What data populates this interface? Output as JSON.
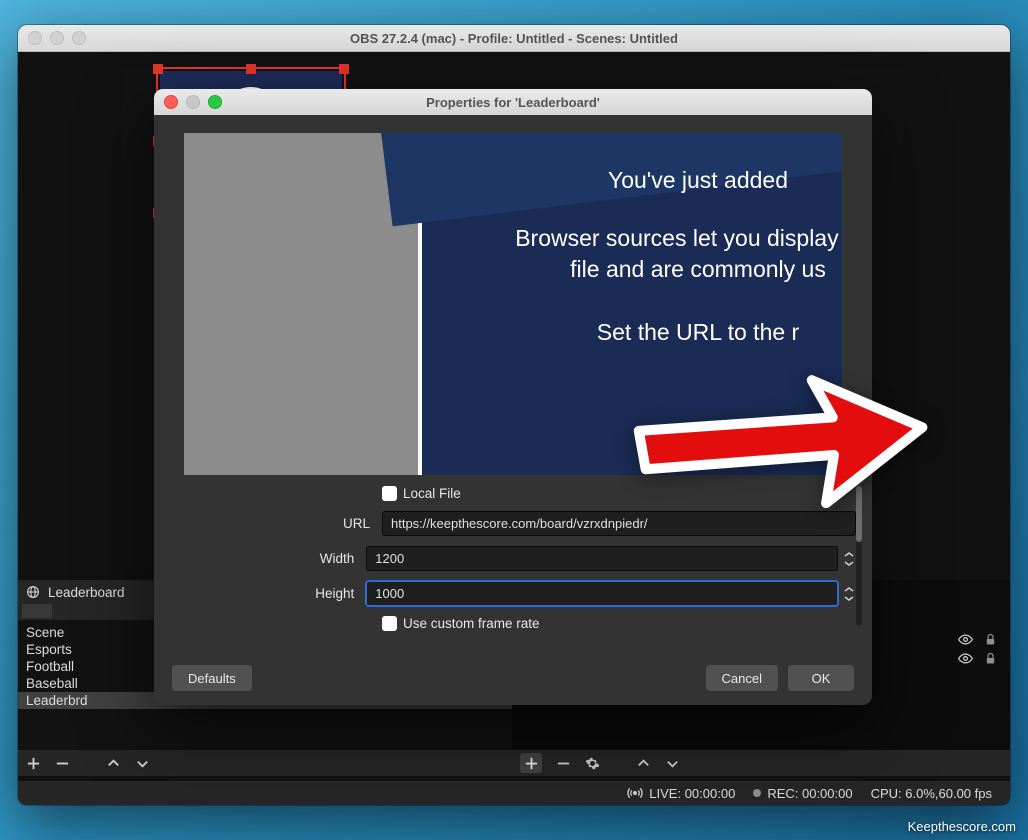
{
  "window": {
    "title": "OBS 27.2.4 (mac) - Profile: Untitled - Scenes: Untitled"
  },
  "sources_panel": {
    "header_label": "Leaderboard",
    "items": [
      "Scene",
      "Esports",
      "Football",
      "Baseball",
      "Leaderbrd"
    ],
    "selected_index": 4
  },
  "status_bar": {
    "live": "LIVE: 00:00:00",
    "rec": "REC: 00:00:00",
    "cpu": "CPU: 6.0%,60.00 fps"
  },
  "modal": {
    "title": "Properties for 'Leaderboard'",
    "preview": {
      "line1": "You've just added",
      "line2": "Browser sources let you display a w\nfile and are commonly us",
      "line3": "Set the URL to the r"
    },
    "form": {
      "local_file_label": "Local File",
      "url_label": "URL",
      "url_value": "https://keepthescore.com/board/vzrxdnpiedr/",
      "width_label": "Width",
      "width_value": "1200",
      "height_label": "Height",
      "height_value": "1000",
      "custom_fps_label": "Use custom frame rate"
    },
    "buttons": {
      "defaults": "Defaults",
      "cancel": "Cancel",
      "ok": "OK"
    }
  },
  "credit": "Keepthescore.com"
}
